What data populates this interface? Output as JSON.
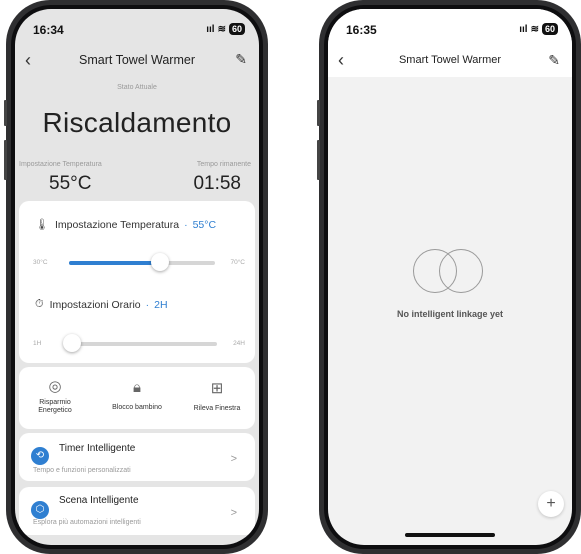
{
  "left_phone": {
    "status_time": "16:34",
    "status_signal": "ııl",
    "status_wifi": "≋",
    "status_battery": "60",
    "title": "Smart Towel Warmer",
    "current_state_label": "Stato Attuale",
    "mode": "Riscaldamento",
    "temp_setting_label": "Impostazione Temperatura",
    "temp_setting_value": "55°C",
    "time_left_label": "Tempo rimanente",
    "time_left_value": "01:58",
    "temperature": {
      "label": "Impostazione Temperatura",
      "separator": "·",
      "value": "55°C",
      "min_label": "30°C",
      "max_label": "70°C",
      "slider_fraction": 0.625
    },
    "schedule": {
      "label": "Impostazioni Orario",
      "separator": "·",
      "value": "2H",
      "min_label": "1H",
      "max_label": "24H",
      "slider_fraction": 0.043
    },
    "functions": [
      {
        "label_line1": "Risparmio",
        "label_line2": "Energetico",
        "icon": "energy-save-icon"
      },
      {
        "label_line1": "Blocco bambino",
        "label_line2": "",
        "icon": "child-lock-icon"
      },
      {
        "label_line1": "Rileva Finestra",
        "label_line2": "",
        "icon": "window-detect-icon"
      }
    ],
    "smart_timer": {
      "title": "Timer Intelligente",
      "subtitle": "Tempo e funzioni personalizzati",
      "chevron": ">"
    },
    "smart_scene": {
      "title": "Scena Intelligente",
      "subtitle": "Esplora più automazioni intelligenti",
      "chevron": ">"
    },
    "colors": {
      "accent": "#2f7fd1",
      "background": "#e5e5e5"
    }
  },
  "right_phone": {
    "status_time": "16:35",
    "status_signal": "ııl",
    "status_wifi": "≋",
    "status_battery": "60",
    "title": "Smart Towel Warmer",
    "empty_message": "No intelligent linkage yet",
    "fab_label": "+"
  }
}
